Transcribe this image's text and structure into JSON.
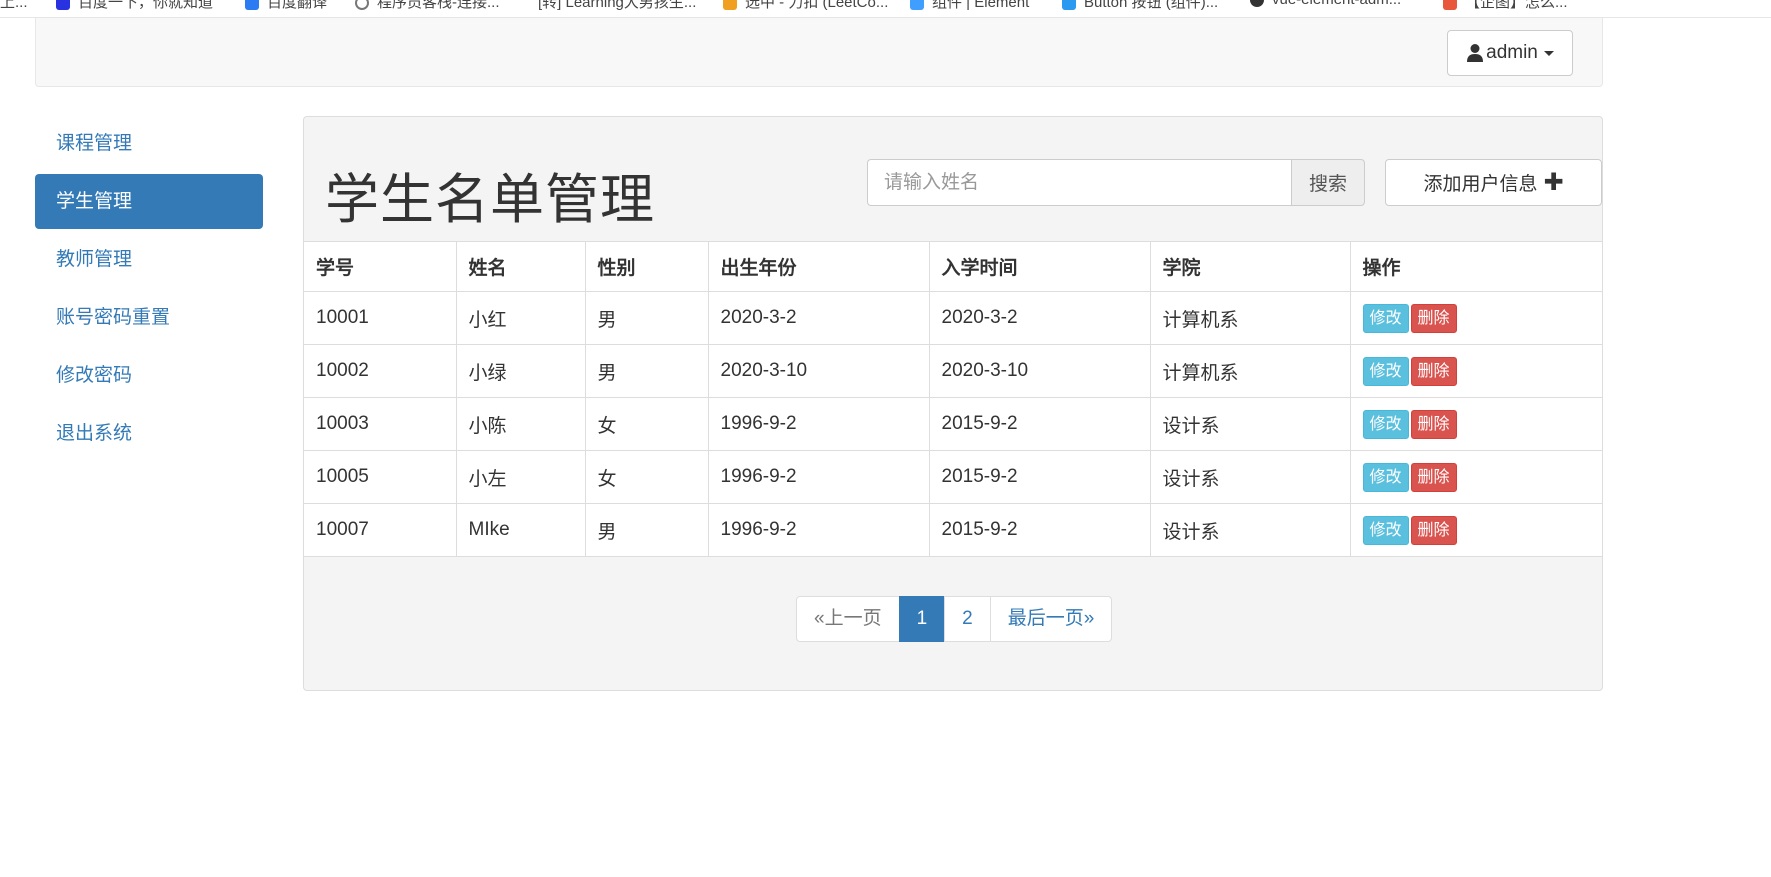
{
  "bookmarks": [
    {
      "label": "上..."
    },
    {
      "label": "百度一下，你就知道",
      "color": "#2932e1"
    },
    {
      "label": "百度翻译",
      "color": "#2b7bf2"
    },
    {
      "label": "程序员客栈-连接...",
      "color": "#777777"
    },
    {
      "label": "[转] Learning大男孩生...",
      "color": "#999999"
    },
    {
      "label": "选中 - 力扣 (LeetCo...",
      "color": "#f0a020"
    },
    {
      "label": "组件 | Element",
      "color": "#409eff"
    },
    {
      "label": "Button 按钮 (组件)...",
      "color": "#2a9af0"
    },
    {
      "label": "vue-element-adm...",
      "color": "#333333"
    },
    {
      "label": "【企图】怎么...",
      "color": "#e8563c"
    }
  ],
  "navbar": {
    "user_label": "admin"
  },
  "sidebar": {
    "items": [
      {
        "label": "课程管理",
        "active": false
      },
      {
        "label": "学生管理",
        "active": true
      },
      {
        "label": "教师管理",
        "active": false
      },
      {
        "label": "账号密码重置",
        "active": false
      },
      {
        "label": "修改密码",
        "active": false
      },
      {
        "label": "退出系统",
        "active": false
      }
    ]
  },
  "main": {
    "title": "学生名单管理",
    "search": {
      "placeholder": "请输入姓名",
      "value": "",
      "button_label": "搜索"
    },
    "add_button_label": "添加用户信息",
    "table": {
      "columns": [
        "学号",
        "姓名",
        "性别",
        "出生年份",
        "入学时间",
        "学院",
        "操作"
      ],
      "rows": [
        [
          "10001",
          "小红",
          "男",
          "2020-3-2",
          "2020-3-2",
          "计算机系"
        ],
        [
          "10002",
          "小绿",
          "男",
          "2020-3-10",
          "2020-3-10",
          "计算机系"
        ],
        [
          "10003",
          "小陈",
          "女",
          "1996-9-2",
          "2015-9-2",
          "设计系"
        ],
        [
          "10005",
          "小左",
          "女",
          "1996-9-2",
          "2015-9-2",
          "设计系"
        ],
        [
          "10007",
          "MIke",
          "男",
          "1996-9-2",
          "2015-9-2",
          "设计系"
        ]
      ],
      "edit_label": "修改",
      "delete_label": "删除"
    },
    "pagination": {
      "prev_label": "«上一页",
      "pages": [
        "1",
        "2"
      ],
      "current_page": "1",
      "last_label": "最后一页»"
    }
  },
  "colors": {
    "primary": "#337ab7",
    "info": "#5bc0de",
    "danger": "#d9534f"
  }
}
